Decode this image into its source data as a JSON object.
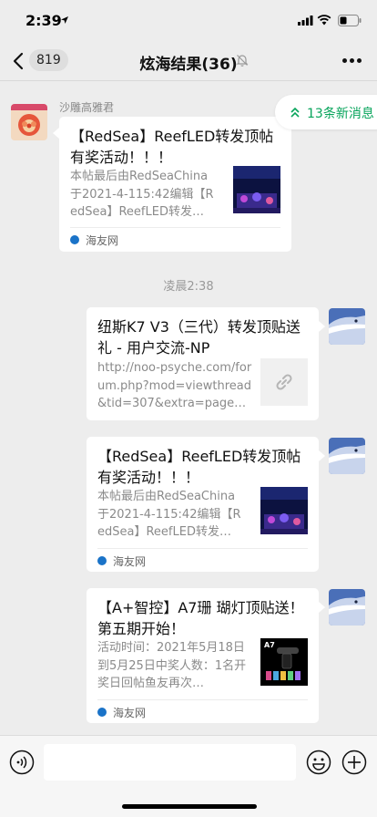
{
  "status_bar": {
    "time": "2:39"
  },
  "nav": {
    "unread_count": "819",
    "title": "炫海结果(36)"
  },
  "new_messages": {
    "label": "13条新消息"
  },
  "messages": [
    {
      "sender": "沙雕高雅君",
      "title": "【RedSea】ReefLED转发顶帖有奖活动！！！",
      "desc": "本帖最后由RedSeaChina 于2021-4-115:42编辑【RedSea】ReefLED转发…",
      "source": "海友网"
    },
    {
      "title": "纽斯K7 V3（三代）转发顶贴送礼 - 用户交流-NP",
      "desc": "http://noo-psyche.com/forum.php?mod=viewthread&tid=307&extra=page…"
    },
    {
      "title": "【RedSea】ReefLED转发顶帖有奖活动！！！",
      "desc": "本帖最后由RedSeaChina 于2021-4-115:42编辑【RedSea】ReefLED转发…",
      "source": "海友网"
    },
    {
      "title": "【A+智控】A7珊 瑚灯顶贴送！第五期开始！",
      "desc": "活动时间：2021年5月18日到5月25日中奖人数：1名开奖日回帖鱼友再次…",
      "source": "海友网",
      "thumb_label": "A7"
    }
  ],
  "timestamp": "凌晨2:38",
  "input": {
    "value": "",
    "placeholder": ""
  },
  "colors": {
    "background": "#ededed",
    "bubble": "#ffffff",
    "accent_green": "#07a45b",
    "source_icon": "#1a73c8"
  },
  "icons": [
    "location-arrow-icon",
    "signal-icon",
    "wifi-icon",
    "battery-icon",
    "back-chevron-icon",
    "mute-bell-icon",
    "more-dots-icon",
    "double-chevron-up-icon",
    "link-icon",
    "voice-icon",
    "emoji-icon",
    "plus-icon"
  ]
}
